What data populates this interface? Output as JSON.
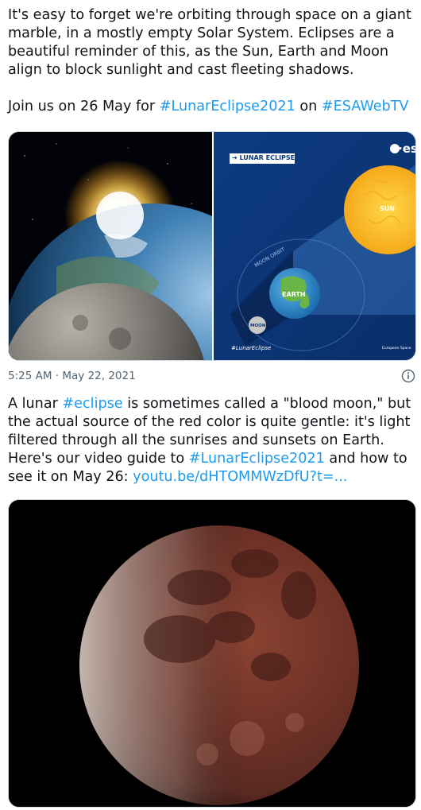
{
  "tweet1": {
    "text": "It's easy to forget we're orbiting through space on a giant marble, in a mostly empty Solar System. Eclipses are a beautiful reminder of this, as the Sun, Earth and Moon align to block sunlight and cast fleeting shadows.",
    "join_prefix": "Join us on 26 May for ",
    "hashtag1": "#LunarEclipse2021",
    "join_mid": " on ",
    "hashtag2": "#ESAWebTV"
  },
  "infographic": {
    "tag": "➔ LUNAR ECLIPSE",
    "logo": "·es",
    "sun_label": "SUN",
    "earth_label": "EARTH",
    "moon_label": "MOON",
    "orbit_label": "MOON ORBIT",
    "hashtag": "#LunarEclipse",
    "credit": "European Space"
  },
  "meta": {
    "timestamp": "5:25 AM · May 22, 2021",
    "info_icon": "info-circle-icon"
  },
  "tweet2": {
    "part1": "A lunar ",
    "hashtag1": "#eclipse",
    "part2": " is sometimes called a \"blood moon,\" but the actual source of the red color is quite gentle: it's light filtered through all the sunrises and sunsets on Earth. Here's our video guide to ",
    "hashtag2": "#LunarEclipse2021",
    "part3": " and how to see it on May 26: ",
    "link": "youtu.be/dHTOMMWzDfU?t=..."
  },
  "colors": {
    "text": "#0f1419",
    "link": "#1d9bf0",
    "meta": "#536471",
    "infographic_bg": "#0b3a7e",
    "sun": "#f7c531",
    "blood_moon": "#7a3a2c"
  }
}
